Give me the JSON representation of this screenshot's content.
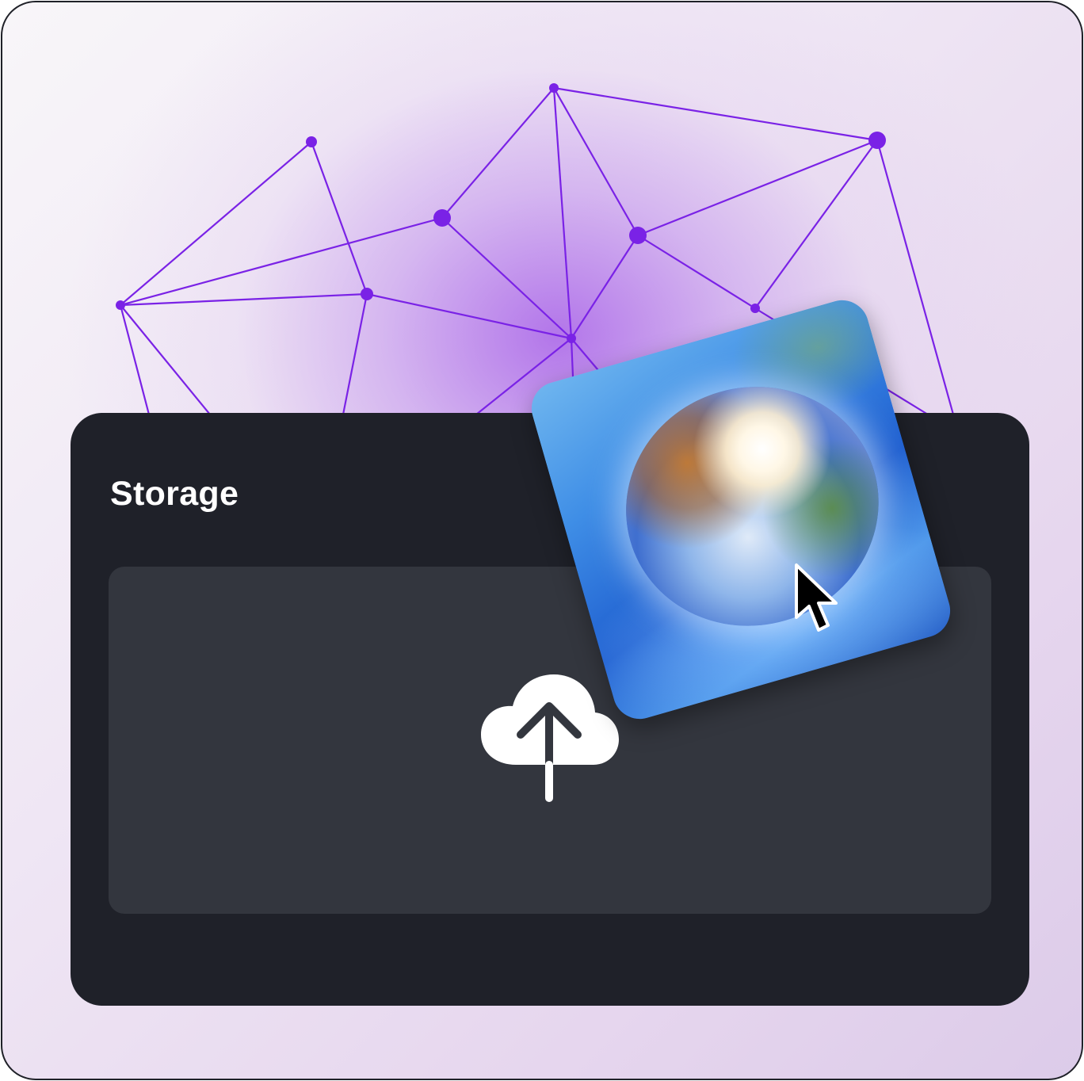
{
  "window": {
    "panel_title": "Storage"
  },
  "icons": {
    "upload": "cloud-upload-icon",
    "cursor": "mouse-pointer-icon",
    "photo": "sphere-photo-thumbnail"
  },
  "colors": {
    "panel_bg": "#1f2129",
    "dropzone_bg": "#33363e",
    "network_accent": "#7a22e6",
    "text": "#ffffff"
  }
}
